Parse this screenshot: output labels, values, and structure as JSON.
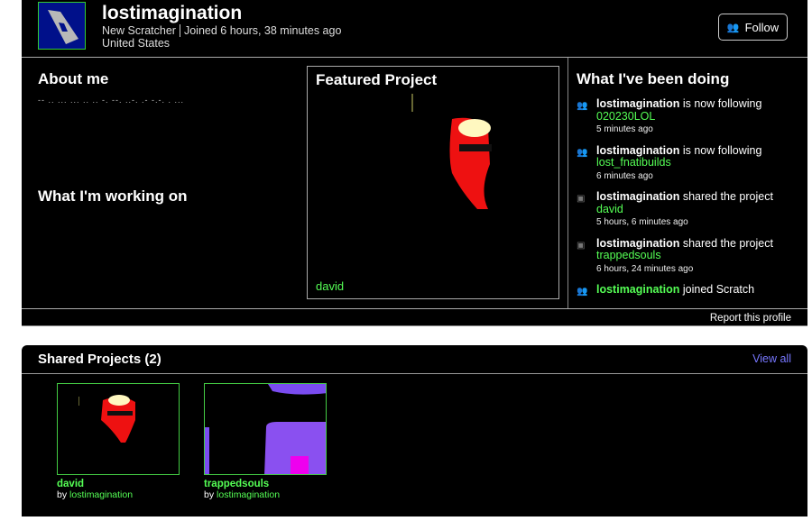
{
  "profile": {
    "username": "lostimagination",
    "rank": "New Scratcher",
    "joined": "Joined 6 hours, 38 minutes ago",
    "location": "United States",
    "follow_label": "Follow"
  },
  "about": {
    "title": "About me",
    "text": "-- .. ... ... .. .. -. --. ..-. .- -.-. . ...",
    "working_title": "What I'm working on"
  },
  "featured": {
    "title": "Featured Project",
    "project": "david"
  },
  "activity": {
    "title": "What I've been doing",
    "items": [
      {
        "icon": "follow-icon",
        "user": "lostimagination",
        "action": "is now following",
        "target": "020230LOL",
        "time": "5 minutes ago"
      },
      {
        "icon": "follow-icon",
        "user": "lostimagination",
        "action": "is now following",
        "target": "lost_fnatibuilds",
        "time": "6 minutes ago"
      },
      {
        "icon": "share-icon",
        "user": "lostimagination",
        "action": "shared the project",
        "target": "david",
        "time": "5 hours, 6 minutes ago"
      },
      {
        "icon": "share-icon",
        "user": "lostimagination",
        "action": "shared the project",
        "target": "trappedsouls",
        "time": "6 hours, 24 minutes ago"
      },
      {
        "icon": "follow-icon",
        "user": "lostimagination",
        "action": "joined Scratch",
        "target": "",
        "time": ""
      }
    ]
  },
  "report_label": "Report this profile",
  "shared": {
    "title": "Shared Projects (2)",
    "view_all": "View all",
    "projects": [
      {
        "title": "david",
        "by": "by",
        "author": "lostimagination"
      },
      {
        "title": "trappedsouls",
        "by": "by",
        "author": "lostimagination"
      }
    ]
  }
}
